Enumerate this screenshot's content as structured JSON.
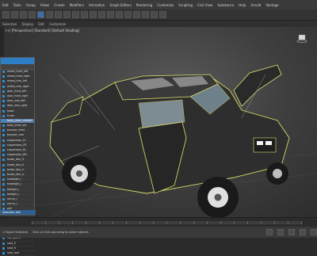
{
  "menu": [
    "Edit",
    "Tools",
    "Group",
    "Views",
    "Create",
    "Modifiers",
    "Animation",
    "Graph Editors",
    "Rendering",
    "Customize",
    "Scripting",
    "Civil View",
    "Substance",
    "Help",
    "Arnold",
    "Vantage"
  ],
  "subbar": [
    "Selection",
    "Display",
    "Edit",
    "Customize"
  ],
  "viewport": {
    "label": "[+] [Perspective] [Standard] [Default Shading]"
  },
  "explorer": {
    "items": [
      "wheel_front_left",
      "wheel_front_right",
      "wheel_rear_left",
      "wheel_rear_right",
      "door_front_left",
      "door_front_right",
      "door_rear_left",
      "door_rear_right",
      "hood",
      "trunk",
      "body_main_cockpit",
      "body_shell_ext",
      "bumper_front",
      "bumper_rear",
      "suspension_FL",
      "suspension_FR",
      "suspension_RL",
      "suspension_RR",
      "brake_disc_fl",
      "brake_disc_fr",
      "brake_disc_rl",
      "brake_disc_rr",
      "headlight_l",
      "headlight_r",
      "taillight_l",
      "taillight_r",
      "mirror_l",
      "mirror_r",
      "grill",
      "windshield",
      "window_fl",
      "window_fr",
      "window_rl",
      "window_rr",
      "roof_panel",
      "seat_fl",
      "seat_fr",
      "seat_rear"
    ],
    "selected_index": 10,
    "footer": "Selection Set:"
  },
  "status": {
    "left": "1 Object Selected",
    "hint": "Click or click-and-drag to select objects"
  }
}
